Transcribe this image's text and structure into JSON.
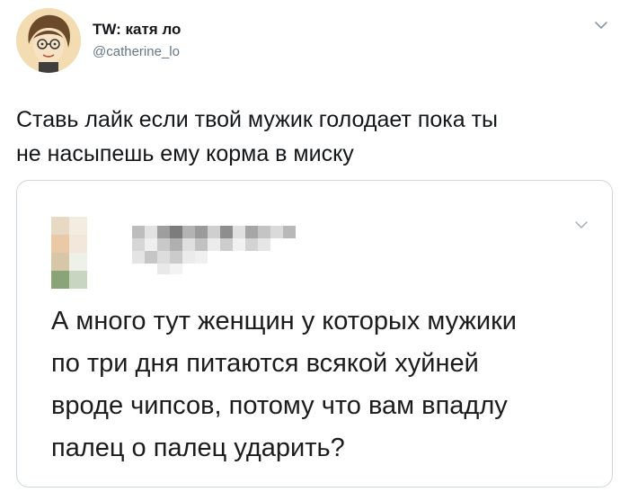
{
  "header": {
    "display_name": "TW: катя ло",
    "handle": "@catherine_lo",
    "avatar_icon": "cartoon-avatar-icon",
    "menu_icon": "chevron-down-icon"
  },
  "tweet": {
    "text_lines": [
      "Ставь лайк если твой мужик голодает пока ты",
      "не насыпешь ему корма в миску"
    ]
  },
  "quote": {
    "author_blurred": true,
    "menu_icon": "chevron-down-icon",
    "text_lines": [
      "А много тут женщин у которых мужики",
      "по три дня питаются всякой хуйней",
      "вроде чипсов, потому что вам впадлу",
      "палец о палец ударить?"
    ]
  },
  "colors": {
    "text_primary": "#14171a",
    "text_secondary": "#657786",
    "border": "#ccd6dd"
  }
}
